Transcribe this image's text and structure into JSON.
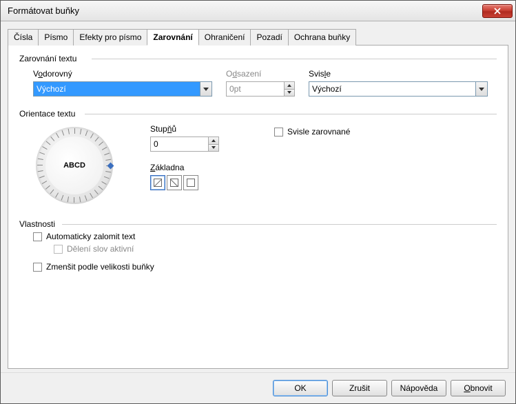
{
  "window": {
    "title": "Formátovat buňky"
  },
  "tabs": [
    {
      "label": "Čísla"
    },
    {
      "label": "Písmo"
    },
    {
      "label": "Efekty pro písmo"
    },
    {
      "label": "Zarovnání"
    },
    {
      "label": "Ohraničení"
    },
    {
      "label": "Pozadí"
    },
    {
      "label": "Ochrana buňky"
    }
  ],
  "active_tab": 3,
  "alignment": {
    "group_label": "Zarovnání textu",
    "horizontal": {
      "label_pre": "V",
      "label_ul": "o",
      "label_post": "dorovný",
      "value": "Výchozí"
    },
    "indent": {
      "label_pre": "O",
      "label_ul": "d",
      "label_post": "sazení",
      "value": "0pt",
      "enabled": false
    },
    "vertical": {
      "label_pre": "Svis",
      "label_ul": "l",
      "label_post": "e",
      "value": "Výchozí"
    }
  },
  "orientation": {
    "group_label": "Orientace textu",
    "dial_text": "ABCD",
    "degrees": {
      "label_pre": "Stup",
      "label_ul": "ň",
      "label_post": "ů",
      "value": "0"
    },
    "refedge": {
      "label_pre": "",
      "label_ul": "Z",
      "label_post": "ákladna"
    },
    "stacked": {
      "label_pre": "Svis",
      "label_ul": "l",
      "label_post": "e zarovnané",
      "checked": false
    }
  },
  "properties": {
    "group_label": "Vlastnosti",
    "wrap": {
      "label_pre": "",
      "label_ul": "A",
      "label_post": "utomaticky zalomit text",
      "checked": false
    },
    "hyphen": {
      "label_pre": "Dělení slov a",
      "label_ul": "k",
      "label_post": "tivní",
      "checked": false,
      "enabled": false
    },
    "shrink": {
      "label_pre": "Zmenšit podle velikosti b",
      "label_ul": "u",
      "label_post": "ňky",
      "checked": false
    }
  },
  "buttons": {
    "ok": "OK",
    "cancel": "Zrušit",
    "help": "Nápověda",
    "reset_pre": "",
    "reset_ul": "O",
    "reset_post": "bnovit"
  }
}
